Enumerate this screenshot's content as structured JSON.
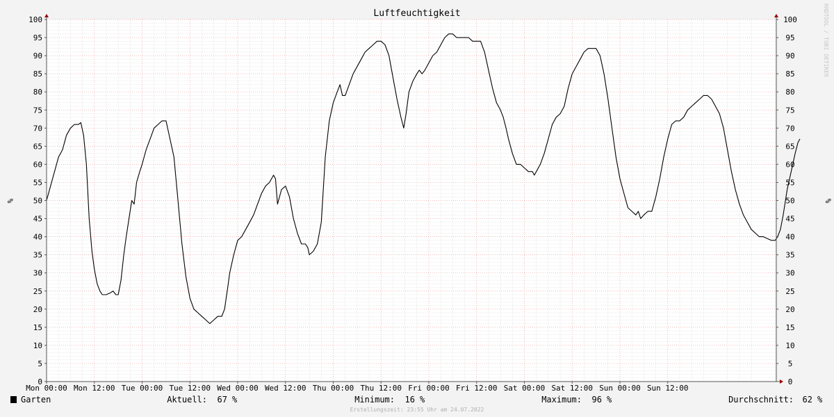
{
  "chart_data": {
    "type": "line",
    "title": "Luftfeuchtigkeit",
    "ylabel": "%",
    "ylim": [
      0,
      100
    ],
    "yticks": [
      0,
      5,
      10,
      15,
      20,
      25,
      30,
      35,
      40,
      45,
      50,
      55,
      60,
      65,
      70,
      75,
      80,
      85,
      90,
      95,
      100
    ],
    "xlim": [
      0,
      168
    ],
    "xticks": [
      {
        "x": 0,
        "label": "Mon 00:00"
      },
      {
        "x": 12,
        "label": "Mon 12:00"
      },
      {
        "x": 24,
        "label": "Tue 00:00"
      },
      {
        "x": 36,
        "label": "Tue 12:00"
      },
      {
        "x": 48,
        "label": "Wed 00:00"
      },
      {
        "x": 60,
        "label": "Wed 12:00"
      },
      {
        "x": 72,
        "label": "Thu 00:00"
      },
      {
        "x": 84,
        "label": "Thu 12:00"
      },
      {
        "x": 96,
        "label": "Fri 00:00"
      },
      {
        "x": 108,
        "label": "Fri 12:00"
      },
      {
        "x": 120,
        "label": "Sat 00:00"
      },
      {
        "x": 132,
        "label": "Sat 12:00"
      },
      {
        "x": 144,
        "label": "Sun 00:00"
      },
      {
        "x": 156,
        "label": "Sun 12:00"
      }
    ],
    "grid": true,
    "series": [
      {
        "name": "Garten",
        "color": "#000000",
        "points": [
          [
            0,
            50
          ],
          [
            1,
            54
          ],
          [
            2,
            58
          ],
          [
            3,
            62
          ],
          [
            4,
            64
          ],
          [
            5,
            68
          ],
          [
            6,
            70
          ],
          [
            7,
            71
          ],
          [
            8,
            71
          ],
          [
            8.6,
            71.5
          ],
          [
            9.3,
            68
          ],
          [
            10,
            60
          ],
          [
            10.7,
            45
          ],
          [
            11.4,
            36
          ],
          [
            12,
            31
          ],
          [
            12.7,
            27
          ],
          [
            13.4,
            25
          ],
          [
            14,
            24
          ],
          [
            15,
            24
          ],
          [
            16,
            24.5
          ],
          [
            16.7,
            25
          ],
          [
            17.4,
            24
          ],
          [
            18,
            24
          ],
          [
            18.7,
            28
          ],
          [
            19.4,
            35
          ],
          [
            20,
            40
          ],
          [
            20.7,
            45
          ],
          [
            21.4,
            50
          ],
          [
            22,
            49
          ],
          [
            22.6,
            55
          ],
          [
            23.4,
            58
          ],
          [
            24,
            60
          ],
          [
            25,
            64
          ],
          [
            26,
            67
          ],
          [
            27,
            70
          ],
          [
            28,
            71
          ],
          [
            29,
            72
          ],
          [
            30,
            72
          ],
          [
            31,
            67
          ],
          [
            32,
            62
          ],
          [
            33,
            50
          ],
          [
            34,
            38
          ],
          [
            35,
            29
          ],
          [
            36,
            23
          ],
          [
            37,
            20
          ],
          [
            38,
            19
          ],
          [
            39,
            18
          ],
          [
            40,
            17
          ],
          [
            41,
            16
          ],
          [
            42,
            17
          ],
          [
            43,
            18
          ],
          [
            44,
            18
          ],
          [
            44.7,
            20
          ],
          [
            45.5,
            26
          ],
          [
            46,
            30
          ],
          [
            47,
            35
          ],
          [
            48,
            39
          ],
          [
            49,
            40
          ],
          [
            50,
            42
          ],
          [
            51,
            44
          ],
          [
            52,
            46
          ],
          [
            53,
            49
          ],
          [
            54,
            52
          ],
          [
            55,
            54
          ],
          [
            56,
            55
          ],
          [
            57,
            57
          ],
          [
            57.5,
            56
          ],
          [
            58,
            49
          ],
          [
            59,
            53
          ],
          [
            60,
            54
          ],
          [
            61,
            51
          ],
          [
            62,
            45
          ],
          [
            63,
            41
          ],
          [
            64,
            38
          ],
          [
            65,
            38
          ],
          [
            65.6,
            37
          ],
          [
            66,
            35
          ],
          [
            67,
            36
          ],
          [
            68,
            38
          ],
          [
            69,
            44
          ],
          [
            70,
            62
          ],
          [
            71,
            72
          ],
          [
            72,
            77
          ],
          [
            73,
            80
          ],
          [
            73.7,
            82
          ],
          [
            74.3,
            79
          ],
          [
            75,
            79
          ],
          [
            76,
            82
          ],
          [
            77,
            85
          ],
          [
            78,
            87
          ],
          [
            79,
            89
          ],
          [
            80,
            91
          ],
          [
            81,
            92
          ],
          [
            82,
            93
          ],
          [
            83,
            94
          ],
          [
            84,
            94
          ],
          [
            85,
            93
          ],
          [
            86,
            90
          ],
          [
            87,
            84
          ],
          [
            88,
            78
          ],
          [
            89,
            73
          ],
          [
            89.7,
            70
          ],
          [
            90.3,
            74
          ],
          [
            91,
            80
          ],
          [
            92,
            83
          ],
          [
            93,
            85
          ],
          [
            93.6,
            86
          ],
          [
            94.3,
            85
          ],
          [
            95,
            86
          ],
          [
            96,
            88
          ],
          [
            97,
            90
          ],
          [
            98,
            91
          ],
          [
            99,
            93
          ],
          [
            100,
            95
          ],
          [
            101,
            96
          ],
          [
            102,
            96
          ],
          [
            103,
            95
          ],
          [
            104,
            95
          ],
          [
            105,
            95
          ],
          [
            106,
            95
          ],
          [
            107,
            94
          ],
          [
            108,
            94
          ],
          [
            109,
            94
          ],
          [
            110,
            91
          ],
          [
            111,
            86
          ],
          [
            112,
            81
          ],
          [
            113,
            77
          ],
          [
            114,
            75
          ],
          [
            114.7,
            73
          ],
          [
            115.4,
            70
          ],
          [
            116,
            67
          ],
          [
            117,
            63
          ],
          [
            118,
            60
          ],
          [
            119,
            60
          ],
          [
            120,
            59
          ],
          [
            121,
            58
          ],
          [
            122,
            58
          ],
          [
            122.5,
            57
          ],
          [
            123,
            58
          ],
          [
            124,
            60
          ],
          [
            125,
            63
          ],
          [
            126,
            67
          ],
          [
            127,
            71
          ],
          [
            128,
            73
          ],
          [
            129,
            74
          ],
          [
            130,
            76
          ],
          [
            131,
            81
          ],
          [
            132,
            85
          ],
          [
            133,
            87
          ],
          [
            134,
            89
          ],
          [
            135,
            91
          ],
          [
            136,
            92
          ],
          [
            137,
            92
          ],
          [
            138,
            92
          ],
          [
            139,
            90
          ],
          [
            140,
            85
          ],
          [
            141,
            78
          ],
          [
            142,
            70
          ],
          [
            143,
            62
          ],
          [
            144,
            56
          ],
          [
            145,
            52
          ],
          [
            146,
            48
          ],
          [
            147,
            47
          ],
          [
            148,
            46
          ],
          [
            148.6,
            47
          ],
          [
            149.2,
            45
          ],
          [
            150,
            46
          ],
          [
            151,
            47
          ],
          [
            152,
            47
          ],
          [
            153,
            51
          ],
          [
            154,
            56
          ],
          [
            155,
            62
          ],
          [
            156,
            67
          ],
          [
            157,
            71
          ],
          [
            158,
            72
          ],
          [
            159,
            72
          ],
          [
            160,
            73
          ],
          [
            161,
            75
          ],
          [
            162,
            76
          ],
          [
            163,
            77
          ],
          [
            164,
            78
          ],
          [
            165,
            79
          ],
          [
            166,
            79
          ],
          [
            167,
            78
          ],
          [
            168,
            76
          ],
          [
            169,
            74
          ],
          [
            170,
            70
          ],
          [
            171,
            64
          ],
          [
            172,
            58
          ],
          [
            173,
            53
          ],
          [
            174,
            49
          ],
          [
            175,
            46
          ],
          [
            176,
            44
          ],
          [
            177,
            42
          ],
          [
            178,
            41
          ],
          [
            179,
            40
          ],
          [
            180,
            40
          ],
          [
            181,
            39.5
          ],
          [
            182,
            39
          ],
          [
            183,
            39
          ],
          [
            183.6,
            40
          ],
          [
            184.3,
            42
          ],
          [
            185,
            46
          ],
          [
            186,
            53
          ],
          [
            187,
            58
          ],
          [
            188,
            63
          ],
          [
            188.7,
            66
          ],
          [
            189.2,
            67
          ]
        ]
      }
    ],
    "stats": [
      {
        "label": "Aktuell:",
        "value": "67",
        "unit": "%"
      },
      {
        "label": "Minimum:",
        "value": "16",
        "unit": "%"
      },
      {
        "label": "Maximum:",
        "value": "96",
        "unit": "%"
      },
      {
        "label": "Durchschnitt:",
        "value": "62",
        "unit": "%"
      }
    ]
  },
  "footer": "Erstellungszeit: 23:55 Uhr am 24.07.2022",
  "watermark": "RRDTOOL / TOBI OETIKER",
  "colors": {
    "background": "#f3f3f3",
    "canvas": "#ffffff",
    "grid_minor": "#d8d8d8",
    "grid_major": "#e8a0a0",
    "axis": "#555555",
    "arrow": "#990000"
  }
}
